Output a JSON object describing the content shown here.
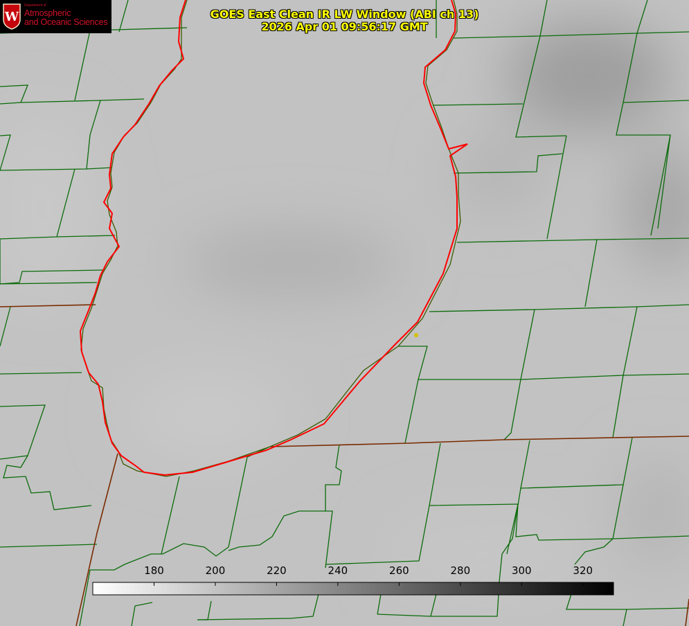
{
  "logo": {
    "seal_letter": "W",
    "dept_small": "Department of",
    "line1": "Atmospheric",
    "line2": "and Oceanic Sciences",
    "color": "#d3122a"
  },
  "title": {
    "line1": "GOES East Clean IR LW Window (ABI ch 13)",
    "line2": "2026 Apr 01 09:56:17 GMT",
    "color": "#ffff00"
  },
  "colorbar": {
    "min": 160,
    "max": 330,
    "ticks": [
      "180",
      "200",
      "220",
      "240",
      "260",
      "280",
      "300",
      "320"
    ],
    "colors": [
      "#ffffff",
      "#000000"
    ]
  },
  "map_colors": {
    "county_lines": "#0b6b0b",
    "state_lines": "#7a2a00",
    "lake_shore": "#ff0000",
    "station_marker": "#d6c000",
    "background": "#c2c2c2"
  }
}
